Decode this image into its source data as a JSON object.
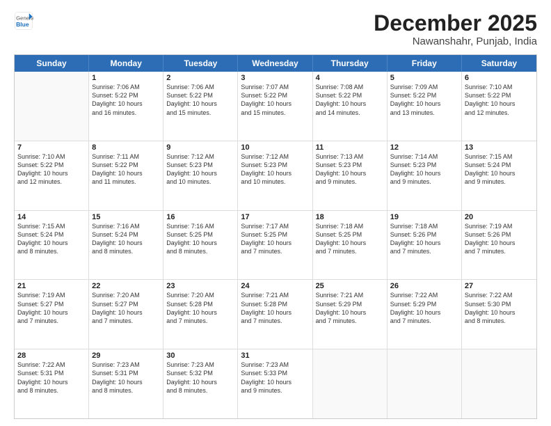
{
  "header": {
    "logo_line1": "General",
    "logo_line2": "Blue",
    "month": "December 2025",
    "location": "Nawanshahr, Punjab, India"
  },
  "days_of_week": [
    "Sunday",
    "Monday",
    "Tuesday",
    "Wednesday",
    "Thursday",
    "Friday",
    "Saturday"
  ],
  "weeks": [
    [
      {
        "day": "",
        "info": ""
      },
      {
        "day": "1",
        "info": "Sunrise: 7:06 AM\nSunset: 5:22 PM\nDaylight: 10 hours\nand 16 minutes."
      },
      {
        "day": "2",
        "info": "Sunrise: 7:06 AM\nSunset: 5:22 PM\nDaylight: 10 hours\nand 15 minutes."
      },
      {
        "day": "3",
        "info": "Sunrise: 7:07 AM\nSunset: 5:22 PM\nDaylight: 10 hours\nand 15 minutes."
      },
      {
        "day": "4",
        "info": "Sunrise: 7:08 AM\nSunset: 5:22 PM\nDaylight: 10 hours\nand 14 minutes."
      },
      {
        "day": "5",
        "info": "Sunrise: 7:09 AM\nSunset: 5:22 PM\nDaylight: 10 hours\nand 13 minutes."
      },
      {
        "day": "6",
        "info": "Sunrise: 7:10 AM\nSunset: 5:22 PM\nDaylight: 10 hours\nand 12 minutes."
      }
    ],
    [
      {
        "day": "7",
        "info": "Sunrise: 7:10 AM\nSunset: 5:22 PM\nDaylight: 10 hours\nand 12 minutes."
      },
      {
        "day": "8",
        "info": "Sunrise: 7:11 AM\nSunset: 5:22 PM\nDaylight: 10 hours\nand 11 minutes."
      },
      {
        "day": "9",
        "info": "Sunrise: 7:12 AM\nSunset: 5:23 PM\nDaylight: 10 hours\nand 10 minutes."
      },
      {
        "day": "10",
        "info": "Sunrise: 7:12 AM\nSunset: 5:23 PM\nDaylight: 10 hours\nand 10 minutes."
      },
      {
        "day": "11",
        "info": "Sunrise: 7:13 AM\nSunset: 5:23 PM\nDaylight: 10 hours\nand 9 minutes."
      },
      {
        "day": "12",
        "info": "Sunrise: 7:14 AM\nSunset: 5:23 PM\nDaylight: 10 hours\nand 9 minutes."
      },
      {
        "day": "13",
        "info": "Sunrise: 7:15 AM\nSunset: 5:24 PM\nDaylight: 10 hours\nand 9 minutes."
      }
    ],
    [
      {
        "day": "14",
        "info": "Sunrise: 7:15 AM\nSunset: 5:24 PM\nDaylight: 10 hours\nand 8 minutes."
      },
      {
        "day": "15",
        "info": "Sunrise: 7:16 AM\nSunset: 5:24 PM\nDaylight: 10 hours\nand 8 minutes."
      },
      {
        "day": "16",
        "info": "Sunrise: 7:16 AM\nSunset: 5:25 PM\nDaylight: 10 hours\nand 8 minutes."
      },
      {
        "day": "17",
        "info": "Sunrise: 7:17 AM\nSunset: 5:25 PM\nDaylight: 10 hours\nand 7 minutes."
      },
      {
        "day": "18",
        "info": "Sunrise: 7:18 AM\nSunset: 5:25 PM\nDaylight: 10 hours\nand 7 minutes."
      },
      {
        "day": "19",
        "info": "Sunrise: 7:18 AM\nSunset: 5:26 PM\nDaylight: 10 hours\nand 7 minutes."
      },
      {
        "day": "20",
        "info": "Sunrise: 7:19 AM\nSunset: 5:26 PM\nDaylight: 10 hours\nand 7 minutes."
      }
    ],
    [
      {
        "day": "21",
        "info": "Sunrise: 7:19 AM\nSunset: 5:27 PM\nDaylight: 10 hours\nand 7 minutes."
      },
      {
        "day": "22",
        "info": "Sunrise: 7:20 AM\nSunset: 5:27 PM\nDaylight: 10 hours\nand 7 minutes."
      },
      {
        "day": "23",
        "info": "Sunrise: 7:20 AM\nSunset: 5:28 PM\nDaylight: 10 hours\nand 7 minutes."
      },
      {
        "day": "24",
        "info": "Sunrise: 7:21 AM\nSunset: 5:28 PM\nDaylight: 10 hours\nand 7 minutes."
      },
      {
        "day": "25",
        "info": "Sunrise: 7:21 AM\nSunset: 5:29 PM\nDaylight: 10 hours\nand 7 minutes."
      },
      {
        "day": "26",
        "info": "Sunrise: 7:22 AM\nSunset: 5:29 PM\nDaylight: 10 hours\nand 7 minutes."
      },
      {
        "day": "27",
        "info": "Sunrise: 7:22 AM\nSunset: 5:30 PM\nDaylight: 10 hours\nand 8 minutes."
      }
    ],
    [
      {
        "day": "28",
        "info": "Sunrise: 7:22 AM\nSunset: 5:31 PM\nDaylight: 10 hours\nand 8 minutes."
      },
      {
        "day": "29",
        "info": "Sunrise: 7:23 AM\nSunset: 5:31 PM\nDaylight: 10 hours\nand 8 minutes."
      },
      {
        "day": "30",
        "info": "Sunrise: 7:23 AM\nSunset: 5:32 PM\nDaylight: 10 hours\nand 8 minutes."
      },
      {
        "day": "31",
        "info": "Sunrise: 7:23 AM\nSunset: 5:33 PM\nDaylight: 10 hours\nand 9 minutes."
      },
      {
        "day": "",
        "info": ""
      },
      {
        "day": "",
        "info": ""
      },
      {
        "day": "",
        "info": ""
      }
    ]
  ]
}
